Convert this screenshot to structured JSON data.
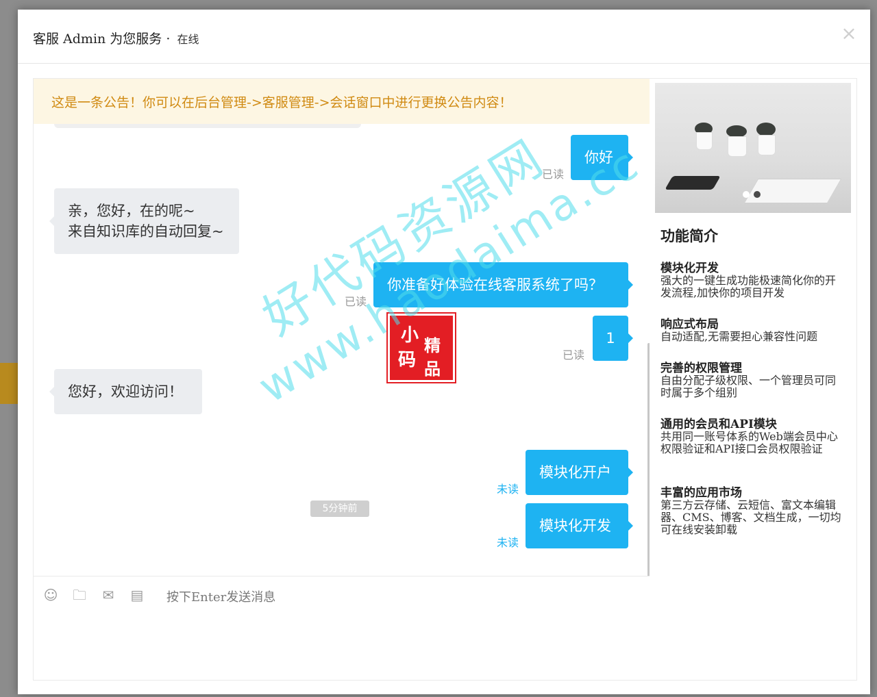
{
  "header": {
    "title": "客服  Admin 为您服务",
    "separator": "·",
    "status": "在线",
    "close_symbol": "×"
  },
  "notice": "这是一条公告！你可以在后台管理->客服管理->会话窗口中进行更换公告内容！",
  "messages": [
    {
      "from": "me",
      "text": "你好",
      "flag": "已读"
    },
    {
      "from": "other",
      "lines": [
        "亲，您好，在的呢~",
        "来自知识库的自动回复~"
      ]
    },
    {
      "from": "me",
      "text": "你准备好体验在线客服系统了吗？",
      "flag": "已读"
    },
    {
      "from": "me",
      "text": "1",
      "flag": "已读"
    },
    {
      "from": "other",
      "text": "您好，欢迎访问！"
    },
    {
      "from": "me",
      "text": "模块化开户",
      "flag": "未读"
    },
    {
      "from": "me",
      "text": "模块化开发",
      "flag": "未读"
    }
  ],
  "time_divider": "5分钟前",
  "input": {
    "placeholder": "按下Enter发送消息",
    "tools": [
      "emoji-icon",
      "folder-icon",
      "file-icon",
      "history-icon"
    ]
  },
  "side": {
    "title": "功能简介",
    "features": [
      {
        "title": "模块化开发",
        "desc": "强大的一键生成功能极速简化你的开发流程,加快你的项目开发"
      },
      {
        "title": "响应式布局",
        "desc": "自动适配,无需要担心兼容性问题"
      },
      {
        "title": "完善的权限管理",
        "desc": "自由分配子级权限、一个管理员可同时属于多个组别"
      },
      {
        "title": "通用的会员和API模块",
        "desc": "共用同一账号体系的Web端会员中心权限验证和API接口会员权限验证"
      },
      {
        "title": "丰富的应用市场",
        "desc": "第三方云存储、云短信、富文本编辑器、CMS、博客、文档生成，一切均可在线安装卸载"
      }
    ]
  },
  "stamp": {
    "chars": [
      "小",
      "精",
      "码",
      "品"
    ]
  },
  "watermark": {
    "line1": "好代码资源网",
    "line2": "www.haodaima.cc"
  },
  "colors": {
    "accent": "#1eb3f2",
    "notice_bg": "#fdf6e3",
    "notice_text": "#d08a12",
    "unread": "#1eb3f2"
  }
}
